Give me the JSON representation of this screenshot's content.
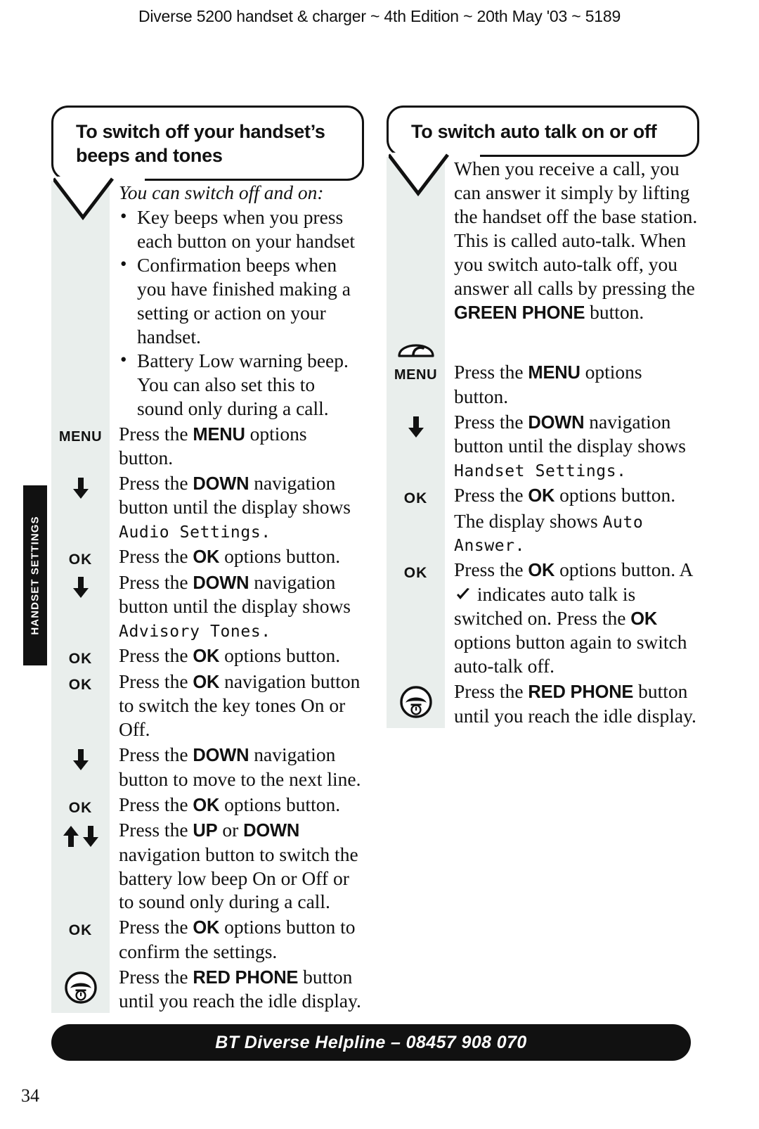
{
  "running_head": "Diverse 5200 handset & charger ~ 4th Edition ~ 20th May '03 ~ 5189",
  "side_tab": {
    "label": "HANDSET SETTINGS"
  },
  "page_number": "34",
  "footer": {
    "text": "BT Diverse Helpline – 08457 908 070"
  },
  "colors": {
    "rail": "#e9eeec",
    "ink": "#111111",
    "paper": "#ffffff"
  },
  "left_column": {
    "heading": "To switch off your handset’s beeps and tones",
    "intro_lead": "You can switch off and on:",
    "bullets": [
      "Key beeps when you press each button on your handset",
      "Confirmation beeps when you have finished making a setting or action on your handset.",
      "Battery Low warning beep. You can also set this to sound only during a call."
    ],
    "steps": [
      {
        "icon": "menu-key",
        "icon_label": "MENU",
        "parts": [
          {
            "t": "Press the "
          },
          {
            "t": "MENU",
            "b": true
          },
          {
            "t": " options button."
          }
        ]
      },
      {
        "icon": "down-arrow",
        "icon_label": "",
        "parts": [
          {
            "t": "Press the "
          },
          {
            "t": "DOWN",
            "b": true
          },
          {
            "t": " navigation button until the display shows "
          },
          {
            "t": "Audio Settings.",
            "lcd": true
          }
        ]
      },
      {
        "icon": "ok-key",
        "icon_label": "OK",
        "parts": [
          {
            "t": "Press the "
          },
          {
            "t": "OK",
            "b": true
          },
          {
            "t": " options button."
          }
        ]
      },
      {
        "icon": "down-arrow",
        "icon_label": "",
        "parts": [
          {
            "t": "Press the "
          },
          {
            "t": "DOWN",
            "b": true
          },
          {
            "t": " navigation button until the display shows "
          },
          {
            "t": "Advisory Tones.",
            "lcd": true
          }
        ]
      },
      {
        "icon": "ok-key",
        "icon_label": "OK",
        "parts": [
          {
            "t": "Press the "
          },
          {
            "t": "OK",
            "b": true
          },
          {
            "t": " options button."
          }
        ]
      },
      {
        "icon": "ok-key",
        "icon_label": "OK",
        "parts": [
          {
            "t": "Press the "
          },
          {
            "t": "OK",
            "b": true
          },
          {
            "t": " navigation button to switch the key tones On or Off."
          }
        ]
      },
      {
        "icon": "down-arrow",
        "icon_label": "",
        "parts": [
          {
            "t": "Press the "
          },
          {
            "t": "DOWN",
            "b": true
          },
          {
            "t": " navigation button to move to the next line."
          }
        ]
      },
      {
        "icon": "ok-key",
        "icon_label": "OK",
        "parts": [
          {
            "t": "Press the "
          },
          {
            "t": "OK",
            "b": true
          },
          {
            "t": " options button."
          }
        ]
      },
      {
        "icon": "up-down-arrows",
        "icon_label": "",
        "parts": [
          {
            "t": "Press the "
          },
          {
            "t": "UP",
            "b": true
          },
          {
            "t": " or "
          },
          {
            "t": "DOWN",
            "b": true
          },
          {
            "t": " navigation button to switch the battery low beep On or Off or to sound only during a call."
          }
        ]
      },
      {
        "icon": "ok-key",
        "icon_label": "OK",
        "parts": [
          {
            "t": "Press the "
          },
          {
            "t": "OK",
            "b": true
          },
          {
            "t": " options button to confirm the settings."
          }
        ]
      },
      {
        "icon": "red-phone-icon",
        "icon_label": "",
        "parts": [
          {
            "t": "Press the "
          },
          {
            "t": "RED PHONE",
            "b": true
          },
          {
            "t": " button until you reach the idle display."
          }
        ]
      }
    ]
  },
  "right_column": {
    "heading": "To switch auto talk on or off",
    "steps": [
      {
        "icon": "none",
        "icon_label": "",
        "parts": [
          {
            "t": "When you receive a call, you can answer it simply by lifting the handset off the base station. This is called auto-talk. When you switch auto-talk off, you answer all calls by pressing the "
          },
          {
            "t": "GREEN PHONE",
            "b": true
          },
          {
            "t": " button."
          }
        ]
      },
      {
        "icon": "green-phone-icon",
        "icon_label": "",
        "parts": []
      },
      {
        "icon": "menu-key",
        "icon_label": "MENU",
        "parts": [
          {
            "t": "Press the "
          },
          {
            "t": "MENU",
            "b": true
          },
          {
            "t": " options button."
          }
        ]
      },
      {
        "icon": "down-arrow",
        "icon_label": "",
        "parts": [
          {
            "t": "Press the "
          },
          {
            "t": "DOWN",
            "b": true
          },
          {
            "t": " navigation button until the display shows "
          },
          {
            "t": "Handset Settings.",
            "lcd": true
          }
        ]
      },
      {
        "icon": "ok-key",
        "icon_label": "OK",
        "parts": [
          {
            "t": "Press the "
          },
          {
            "t": "OK",
            "b": true
          },
          {
            "t": " options button."
          }
        ]
      },
      {
        "icon": "none",
        "icon_label": "",
        "parts": [
          {
            "t": "The display shows "
          },
          {
            "t": "Auto Answer.",
            "lcd": true
          }
        ]
      },
      {
        "icon": "ok-key",
        "icon_label": "OK",
        "parts": [
          {
            "t": "Press the "
          },
          {
            "t": "OK",
            "b": true
          },
          {
            "t": " options button. A "
          },
          {
            "t": "",
            "check": true
          },
          {
            "t": " indicates auto talk is switched on. Press the "
          },
          {
            "t": "OK",
            "b": true
          },
          {
            "t": " options button again to switch auto-talk off."
          }
        ]
      },
      {
        "icon": "red-phone-icon",
        "icon_label": "",
        "parts": [
          {
            "t": "Press the "
          },
          {
            "t": "RED PHONE",
            "b": true
          },
          {
            "t": " button until you reach the idle display."
          }
        ]
      }
    ]
  }
}
